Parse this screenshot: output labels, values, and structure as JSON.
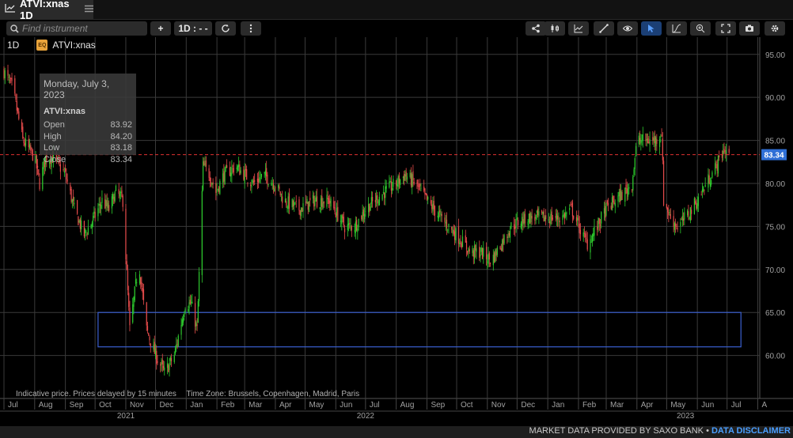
{
  "window": {
    "title": "ATVI:xnas 1D"
  },
  "toolbar": {
    "search_placeholder": "Find instrument",
    "add_label": "+",
    "timeframe_label": "1D : - -",
    "icons": [
      "share-icon",
      "candlestick-type-icon",
      "indicators-icon",
      "draw-line-icon",
      "visibility-icon",
      "pointer-icon",
      "curve-tool-icon",
      "zoom-in-icon",
      "fullscreen-icon",
      "camera-icon",
      "settings-icon"
    ]
  },
  "instrument": {
    "timeframe": "1D",
    "badge": "EQ",
    "symbol": "ATVI:xnas"
  },
  "tooltip": {
    "date": "Monday, July 3, 2023",
    "symbol": "ATVI:xnas",
    "rows": [
      {
        "label": "Open",
        "value": "83.92"
      },
      {
        "label": "High",
        "value": "84.20"
      },
      {
        "label": "Low",
        "value": "83.18"
      },
      {
        "label": "Close",
        "value": "83.34"
      }
    ]
  },
  "footnote": {
    "delay": "Indicative price. Prices delayed by 15 minutes",
    "timezone": "Time Zone: Brussels, Copenhagen, Madrid, Paris"
  },
  "bottom": {
    "provided": "MARKET DATA PROVIDED BY SAXO BANK • ",
    "disclaimer": "DATA DISCLAIMER"
  },
  "chart_data": {
    "type": "candlestick",
    "ylim": [
      55,
      97
    ],
    "yticks": [
      "95.00",
      "90.00",
      "85.00",
      "80.00",
      "75.00",
      "70.00",
      "65.00",
      "60.00"
    ],
    "xticks": [
      "Jul",
      "Aug",
      "Sep",
      "Oct",
      "Nov",
      "Dec",
      "Jan",
      "Feb",
      "Mar",
      "Apr",
      "May",
      "Jun",
      "Jul",
      "Aug",
      "Sep",
      "Oct",
      "Nov",
      "Dec",
      "Jan",
      "Feb",
      "Mar",
      "Apr",
      "May",
      "Jun",
      "Jul",
      "A"
    ],
    "years": [
      "2021",
      "2022",
      "2023"
    ],
    "last_price": "83.34",
    "last_price_value": 83.34,
    "range_box": {
      "start": "Sep 2021",
      "end": "Jul 2023",
      "low": 61.0,
      "high": 65.0
    },
    "colors": {
      "up": "#2ecc2e",
      "down": "#e84c4c",
      "last": "#2f6fd6",
      "box": "#3a5fd0",
      "grid": "#3a3a3a"
    },
    "path": [
      [
        "2021-07-01",
        93
      ],
      [
        "2021-07-10",
        91
      ],
      [
        "2021-07-20",
        85
      ],
      [
        "2021-08-01",
        83
      ],
      [
        "2021-08-06",
        80
      ],
      [
        "2021-08-12",
        83
      ],
      [
        "2021-08-20",
        83
      ],
      [
        "2021-09-01",
        81
      ],
      [
        "2021-09-10",
        77
      ],
      [
        "2021-09-20",
        74
      ],
      [
        "2021-09-30",
        76
      ],
      [
        "2021-10-08",
        78
      ],
      [
        "2021-10-15",
        77
      ],
      [
        "2021-10-22",
        79
      ],
      [
        "2021-10-29",
        78
      ],
      [
        "2021-11-05",
        63
      ],
      [
        "2021-11-12",
        69
      ],
      [
        "2021-11-15",
        70
      ],
      [
        "2021-11-22",
        63
      ],
      [
        "2021-12-01",
        60
      ],
      [
        "2021-12-10",
        58
      ],
      [
        "2021-12-20",
        60
      ],
      [
        "2021-12-31",
        66
      ],
      [
        "2022-01-06",
        66
      ],
      [
        "2022-01-12",
        63
      ],
      [
        "2022-01-18",
        82
      ],
      [
        "2022-01-25",
        81
      ],
      [
        "2022-01-31",
        79
      ],
      [
        "2022-02-08",
        81
      ],
      [
        "2022-02-20",
        82
      ],
      [
        "2022-03-01",
        81
      ],
      [
        "2022-03-10",
        80
      ],
      [
        "2022-03-20",
        81
      ],
      [
        "2022-03-31",
        80
      ],
      [
        "2022-04-10",
        78
      ],
      [
        "2022-04-25",
        77
      ],
      [
        "2022-05-10",
        78
      ],
      [
        "2022-05-25",
        78
      ],
      [
        "2022-06-10",
        75
      ],
      [
        "2022-06-20",
        75
      ],
      [
        "2022-07-01",
        77
      ],
      [
        "2022-07-10",
        78
      ],
      [
        "2022-07-20",
        79
      ],
      [
        "2022-08-01",
        80
      ],
      [
        "2022-08-10",
        81
      ],
      [
        "2022-08-20",
        80
      ],
      [
        "2022-09-01",
        78
      ],
      [
        "2022-09-15",
        76
      ],
      [
        "2022-10-01",
        74
      ],
      [
        "2022-10-15",
        72
      ],
      [
        "2022-10-25",
        72
      ],
      [
        "2022-11-05",
        71
      ],
      [
        "2022-11-15",
        73
      ],
      [
        "2022-11-25",
        75
      ],
      [
        "2022-12-10",
        76
      ],
      [
        "2022-12-20",
        76
      ],
      [
        "2023-01-05",
        76
      ],
      [
        "2023-01-15",
        76
      ],
      [
        "2023-01-25",
        77
      ],
      [
        "2023-02-05",
        74
      ],
      [
        "2023-02-10",
        73
      ],
      [
        "2023-02-20",
        75
      ],
      [
        "2023-03-01",
        77
      ],
      [
        "2023-03-10",
        78
      ],
      [
        "2023-03-20",
        79
      ],
      [
        "2023-03-27",
        80
      ],
      [
        "2023-04-01",
        85
      ],
      [
        "2023-04-10",
        85
      ],
      [
        "2023-04-20",
        85
      ],
      [
        "2023-04-26",
        86
      ],
      [
        "2023-04-28",
        78
      ],
      [
        "2023-05-05",
        76
      ],
      [
        "2023-05-12",
        75
      ],
      [
        "2023-05-20",
        76
      ],
      [
        "2023-06-01",
        78
      ],
      [
        "2023-06-10",
        80
      ],
      [
        "2023-06-20",
        82
      ],
      [
        "2023-06-28",
        84
      ],
      [
        "2023-07-03",
        83.34
      ]
    ]
  }
}
